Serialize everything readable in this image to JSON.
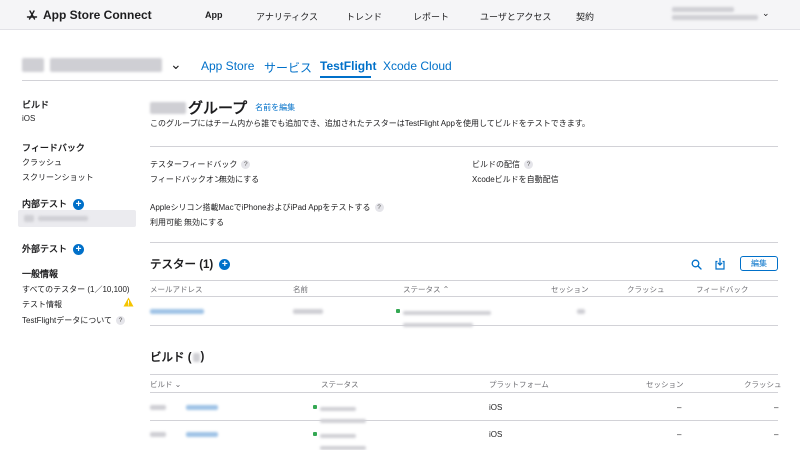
{
  "header": {
    "brand": "App Store Connect",
    "nav": [
      {
        "label": "App",
        "active": true
      },
      {
        "label": "アナリティクス"
      },
      {
        "label": "トレンド"
      },
      {
        "label": "レポート"
      },
      {
        "label": "ユーザとアクセス"
      },
      {
        "label": "契約"
      }
    ]
  },
  "app_tabs": [
    "App Store",
    "サービス",
    "TestFlight",
    "Xcode Cloud"
  ],
  "active_tab": "TestFlight",
  "sidebar": {
    "build_heading": "ビルド",
    "build_items": [
      "iOS"
    ],
    "feedback_heading": "フィードバック",
    "feedback_items": [
      "クラッシュ",
      "スクリーンショット"
    ],
    "internal_heading": "内部テスト",
    "external_heading": "外部テスト",
    "general_heading": "一般情報",
    "general_items": [
      "すべてのテスター (1／10,100)",
      "テスト情報",
      "TestFlightデータについて"
    ]
  },
  "group": {
    "title_suffix": "グループ",
    "edit_name": "名前を編集",
    "description": "このグループにはチーム内から誰でも追加でき、追加されたテスターはTestFlight Appを使用してビルドをテストできます。",
    "tester_feedback_label": "テスターフィードバック",
    "feedback_on": "フィードバックオン",
    "disable": "無効にする",
    "build_distribution_label": "ビルドの配信",
    "auto_distribute": "Xcodeビルドを自動配信",
    "apple_silicon_label": "Appleシリコン搭載MacでiPhoneおよびiPad Appをテストする",
    "available": "利用可能",
    "disable2": "無効にする"
  },
  "testers": {
    "title": "テスター (1)",
    "edit_button": "編集",
    "columns": [
      "メールアドレス",
      "名前",
      "ステータス",
      "セッション",
      "クラッシュ",
      "フィードバック"
    ],
    "status_sort_icon": "chevron-up"
  },
  "builds": {
    "title_prefix": "ビルド (",
    "title_suffix": ")",
    "columns": [
      "ビルド",
      "ステータス",
      "プラットフォーム",
      "セッション",
      "クラッシュ"
    ],
    "rows": [
      {
        "platform": "iOS",
        "sessions": "–",
        "crashes": "–"
      },
      {
        "platform": "iOS",
        "sessions": "–",
        "crashes": "–"
      }
    ]
  },
  "colors": {
    "accent": "#0070c9",
    "warning": "#f5c400",
    "status": "#34a853"
  }
}
